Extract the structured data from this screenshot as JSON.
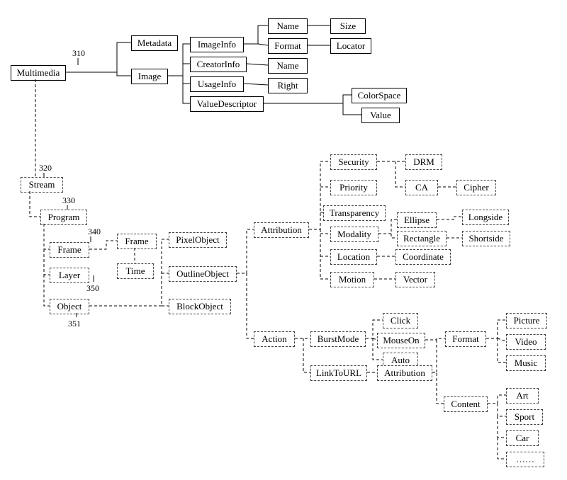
{
  "nodes": {
    "multimedia": "Multimedia",
    "metadata": "Metadata",
    "image": "Image",
    "imageinfo": "ImageInfo",
    "creatorinfo": "CreatorInfo",
    "usageinfo": "UsageInfo",
    "valuedescriptor": "ValueDescriptor",
    "name1": "Name",
    "format1": "Format",
    "name2": "Name",
    "right": "Right",
    "size": "Size",
    "locator": "Locator",
    "colorspace": "ColorSpace",
    "value": "Value",
    "stream": "Stream",
    "program": "Program",
    "frame1": "Frame",
    "layer": "Layer",
    "object": "Object",
    "frame2": "Frame",
    "time": "Time",
    "pixelobject": "PixelObject",
    "outlineobject": "OutlineObject",
    "blockobject": "BlockObject",
    "attribution": "Attribution",
    "action": "Action",
    "security": "Security",
    "priority": "Priority",
    "transparency": "Transparency",
    "modality": "Modality",
    "location": "Location",
    "motion": "Motion",
    "drm": "DRM",
    "ca": "CA",
    "cipher": "Cipher",
    "ellipse": "Ellipse",
    "rectangle": "Rectangle",
    "longside": "Longside",
    "shortside": "Shortside",
    "coordinate": "Coordinate",
    "vector": "Vector",
    "burstmode": "BurstMode",
    "linktourl": "LinkToURL",
    "click": "Click",
    "mouseon": "MouseOn",
    "auto": "Auto",
    "attribution2": "Attribution",
    "format2": "Format",
    "content": "Content",
    "picture": "Picture",
    "video": "Video",
    "music": "Music",
    "art": "Art",
    "sport": "Sport",
    "car": "Car",
    "more": "……"
  },
  "refs": {
    "r310": "310",
    "r320": "320",
    "r330": "330",
    "r340": "340",
    "r350": "350",
    "r351": "351"
  }
}
